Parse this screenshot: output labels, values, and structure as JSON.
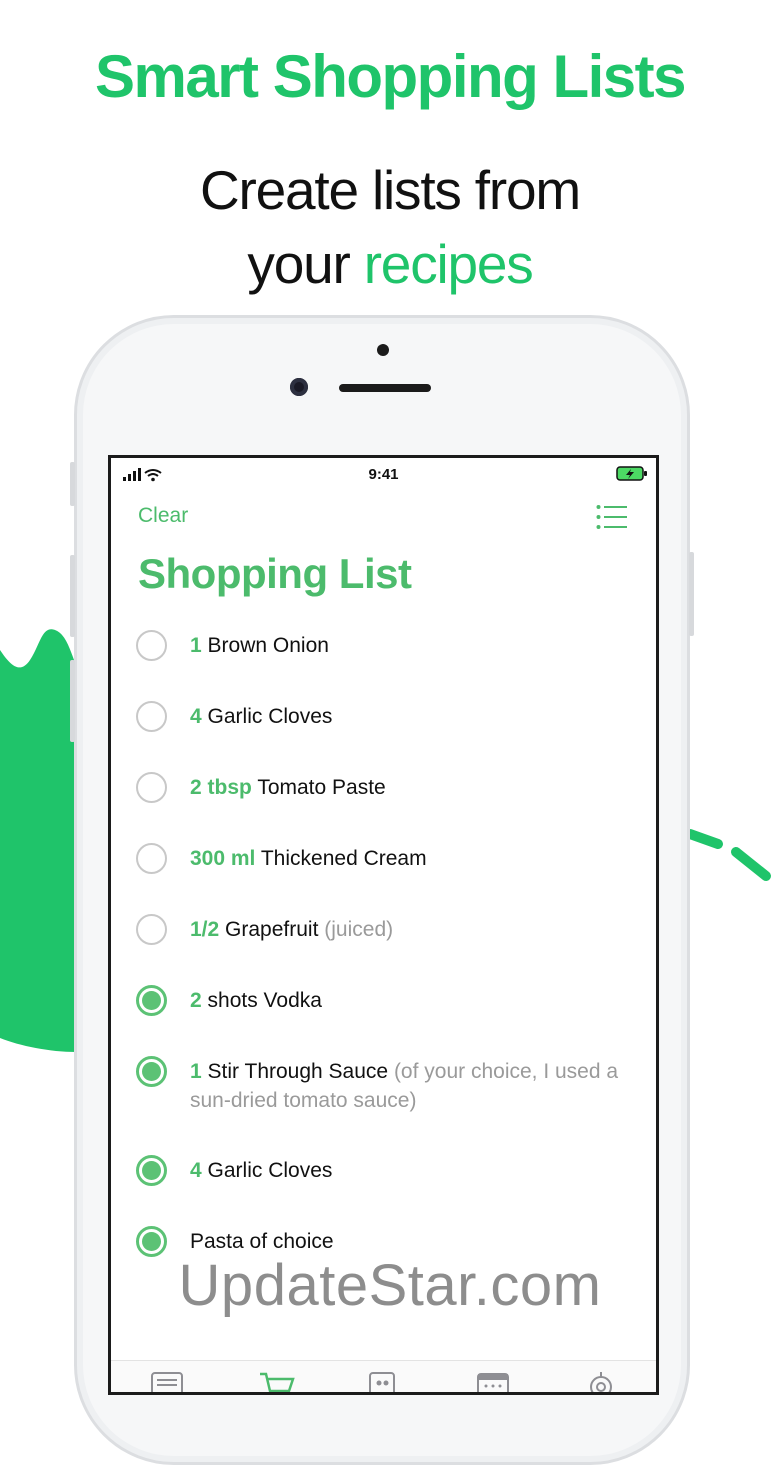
{
  "headline": "Smart Shopping Lists",
  "subline": {
    "line1": "Create lists from",
    "line2_plain": "your",
    "line2_accent": "recipes"
  },
  "status_bar": {
    "time": "9:41"
  },
  "nav": {
    "clear_label": "Clear"
  },
  "page_title": "Shopping List",
  "items": [
    {
      "qty": "1",
      "name": "Brown Onion",
      "note": "",
      "checked": false
    },
    {
      "qty": "4",
      "name": "Garlic Cloves",
      "note": "",
      "checked": false
    },
    {
      "qty": "2 tbsp",
      "name": "Tomato Paste",
      "note": "",
      "checked": false
    },
    {
      "qty": "300 ml",
      "name": "Thickened Cream",
      "note": "",
      "checked": false
    },
    {
      "qty": "1/2",
      "name": "Grapefruit",
      "note": "(juiced)",
      "checked": false
    },
    {
      "qty": "2",
      "name": "shots Vodka",
      "note": "",
      "checked": true
    },
    {
      "qty": "1",
      "name": "Stir Through Sauce",
      "note": "(of your choice, I used a sun-dried tomato sauce)",
      "checked": true
    },
    {
      "qty": "4",
      "name": "Garlic Cloves",
      "note": "",
      "checked": true
    },
    {
      "qty": "",
      "name": "Pasta of choice",
      "note": "",
      "checked": true
    }
  ],
  "tabs": [
    "list-icon",
    "cart-icon",
    "quote-icon",
    "calendar-icon",
    "gear-icon"
  ],
  "watermark": "UpdateStar.com",
  "colors": {
    "brand": "#1fc46a",
    "accent": "#4cbb6c",
    "check": "#5cc275"
  }
}
